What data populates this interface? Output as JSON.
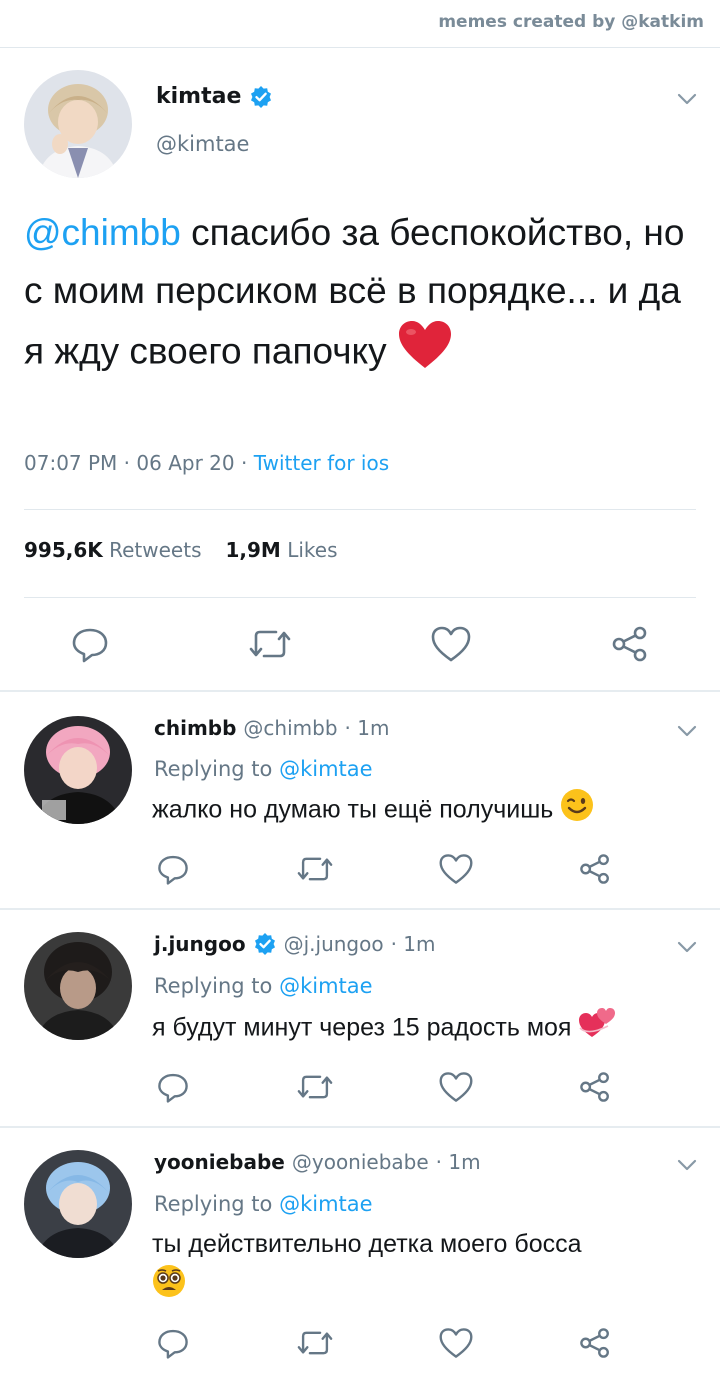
{
  "credit": "memes created by @katkim",
  "main": {
    "name": "kimtae",
    "handle": "@kimtae",
    "mention": "@chimbb",
    "text": " спасибо за беспокойство, но с моим персиком всё в порядке... и да я жду своего папочку",
    "time": "07:07 PM",
    "date": "06 Apr 20",
    "dot": "·",
    "source": "Twitter for ios",
    "retweets_count": "995,6K",
    "retweets_label": "Retweets",
    "likes_count": "1,9M",
    "likes_label": "Likes"
  },
  "replies": [
    {
      "name": "chimbb",
      "handle": "@chimbb",
      "time": "· 1m",
      "replying": "Replying to",
      "to": "@kimtae",
      "text": "жалко но думаю ты ещё получишь"
    },
    {
      "name": "j.jungoo",
      "handle": "@j.jungoo",
      "time": "· 1m",
      "replying": "Replying to",
      "to": "@kimtae",
      "text": "я будут минут через 15 радость моя"
    },
    {
      "name": "yooniebabe",
      "handle": "@yooniebabe",
      "time": "· 1m",
      "replying": "Replying to",
      "to": "@kimtae",
      "text": "ты действительно детка моего босса"
    }
  ],
  "colors": {
    "accent": "#1da1f2",
    "muted": "#657786",
    "heart": "#e0245e"
  },
  "icons": [
    "chevron-down-icon",
    "verified-badge-icon",
    "reply-icon",
    "retweet-icon",
    "like-icon",
    "share-icon",
    "red-heart-emoji",
    "wink-emoji",
    "two-hearts-emoji",
    "pleading-emoji"
  ]
}
